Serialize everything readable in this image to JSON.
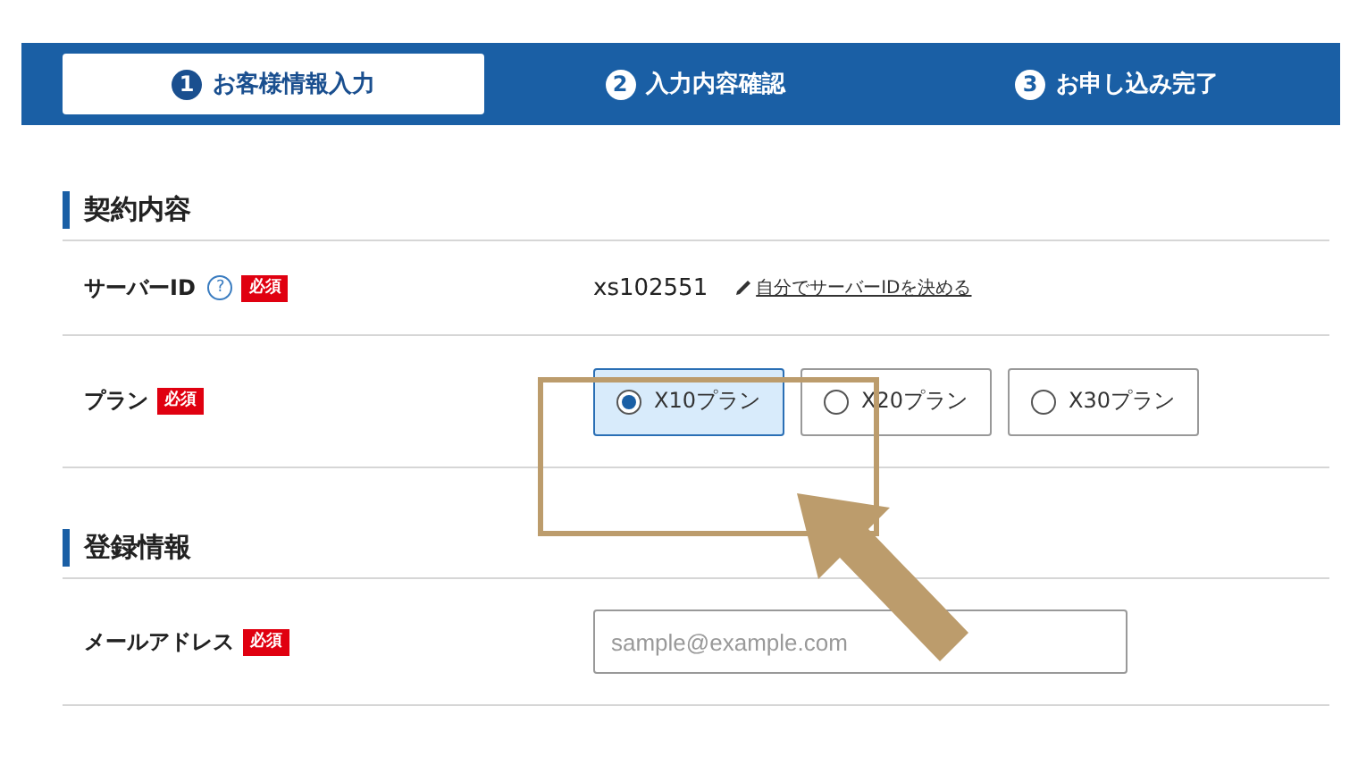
{
  "steps": [
    {
      "number": "1",
      "label": "お客様情報入力",
      "selected": true
    },
    {
      "number": "2",
      "label": "入力内容確認",
      "selected": false
    },
    {
      "number": "3",
      "label": "お申し込み完了",
      "selected": false
    }
  ],
  "sections": [
    {
      "heading": "契約内容",
      "rows": [
        {
          "kind": "server-id",
          "label": "サーバーID",
          "help": "?",
          "required": "必須",
          "value": "xs102551",
          "link": "自分でサーバーIDを決める"
        },
        {
          "kind": "radio",
          "label": "プラン",
          "required": "必須",
          "options": [
            {
              "label": "X10プラン",
              "selected": true
            },
            {
              "label": "X20プラン",
              "selected": false
            },
            {
              "label": "X30プラン",
              "selected": false
            }
          ]
        }
      ]
    },
    {
      "heading": "登録情報",
      "rows": [
        {
          "kind": "input",
          "label": "メールアドレス",
          "required": "必須",
          "placeholder": "sample@example.com"
        }
      ]
    }
  ],
  "annotation": {
    "kind": "highlight-arrow"
  }
}
